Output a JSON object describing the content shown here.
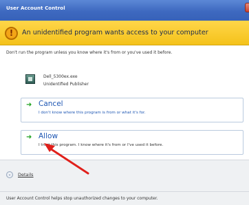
{
  "window": {
    "title": "User Account Control"
  },
  "warning": {
    "icon": "warning-shield-icon",
    "message": "An unidentified program wants access to your computer"
  },
  "intro": {
    "text": "Don't run the program unless you know where it's from or you've used it before."
  },
  "program": {
    "icon": "program-file-icon",
    "file_name": "Dell_5300ex.exe",
    "publisher": "Unidentified Publisher"
  },
  "options": {
    "cancel": {
      "label": "Cancel",
      "description": "I don't know where this program is from or what it's for."
    },
    "allow": {
      "label": "Allow",
      "description": "I trust this program. I know where it's from or I've used it before."
    }
  },
  "details": {
    "label": "Details"
  },
  "footer": {
    "text": "User Account Control helps stop unauthorized changes to your computer."
  },
  "colors": {
    "title_bar": "#3e69c0",
    "warning_band": "#f4c21a",
    "option_text": "#1d56b3",
    "option_arrow": "#21a321",
    "annotation_arrow": "#e0201b"
  }
}
